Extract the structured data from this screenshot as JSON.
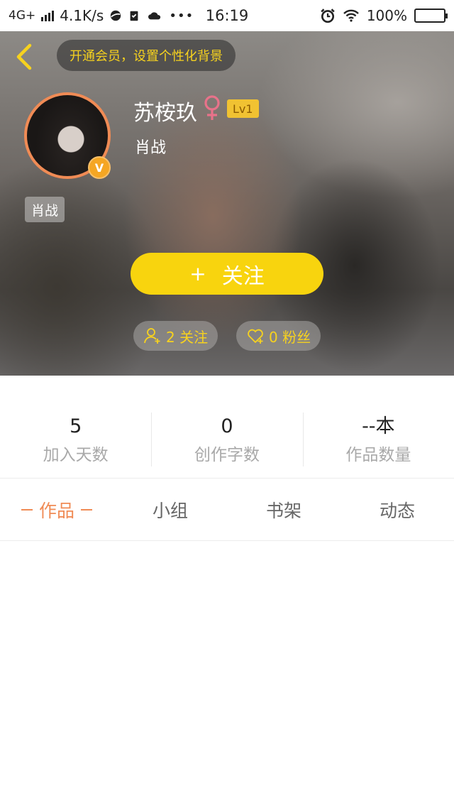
{
  "status_bar": {
    "network": "4G+",
    "speed": "4.1K/s",
    "time": "16:19",
    "battery": "100%",
    "icons": [
      "signal-icon",
      "browser-icon",
      "clipboard-icon",
      "cloud-icon",
      "more-icon",
      "alarm-icon",
      "wifi-icon",
      "battery-icon"
    ]
  },
  "header": {
    "vip_banner": "开通会员，设置个性化背景",
    "user_name": "苏桉玖",
    "gender": "female",
    "level": "Lv1",
    "signature": "肖战",
    "tag": "肖战",
    "avatar_badge": "V",
    "follow_button": {
      "plus": "+",
      "label": "关注"
    },
    "following": "2 关注",
    "fans": "0 粉丝",
    "accent_color": "#f8d40e"
  },
  "stats": [
    {
      "value": "5",
      "label": "加入天数"
    },
    {
      "value": "0",
      "label": "创作字数"
    },
    {
      "value": "--本",
      "label": "作品数量"
    }
  ],
  "tabs": [
    {
      "label": "作品",
      "active": true
    },
    {
      "label": "小组",
      "active": false
    },
    {
      "label": "书架",
      "active": false
    },
    {
      "label": "动态",
      "active": false
    }
  ],
  "colors": {
    "active_tab": "#f08b55",
    "gold": "#f7d21e"
  }
}
